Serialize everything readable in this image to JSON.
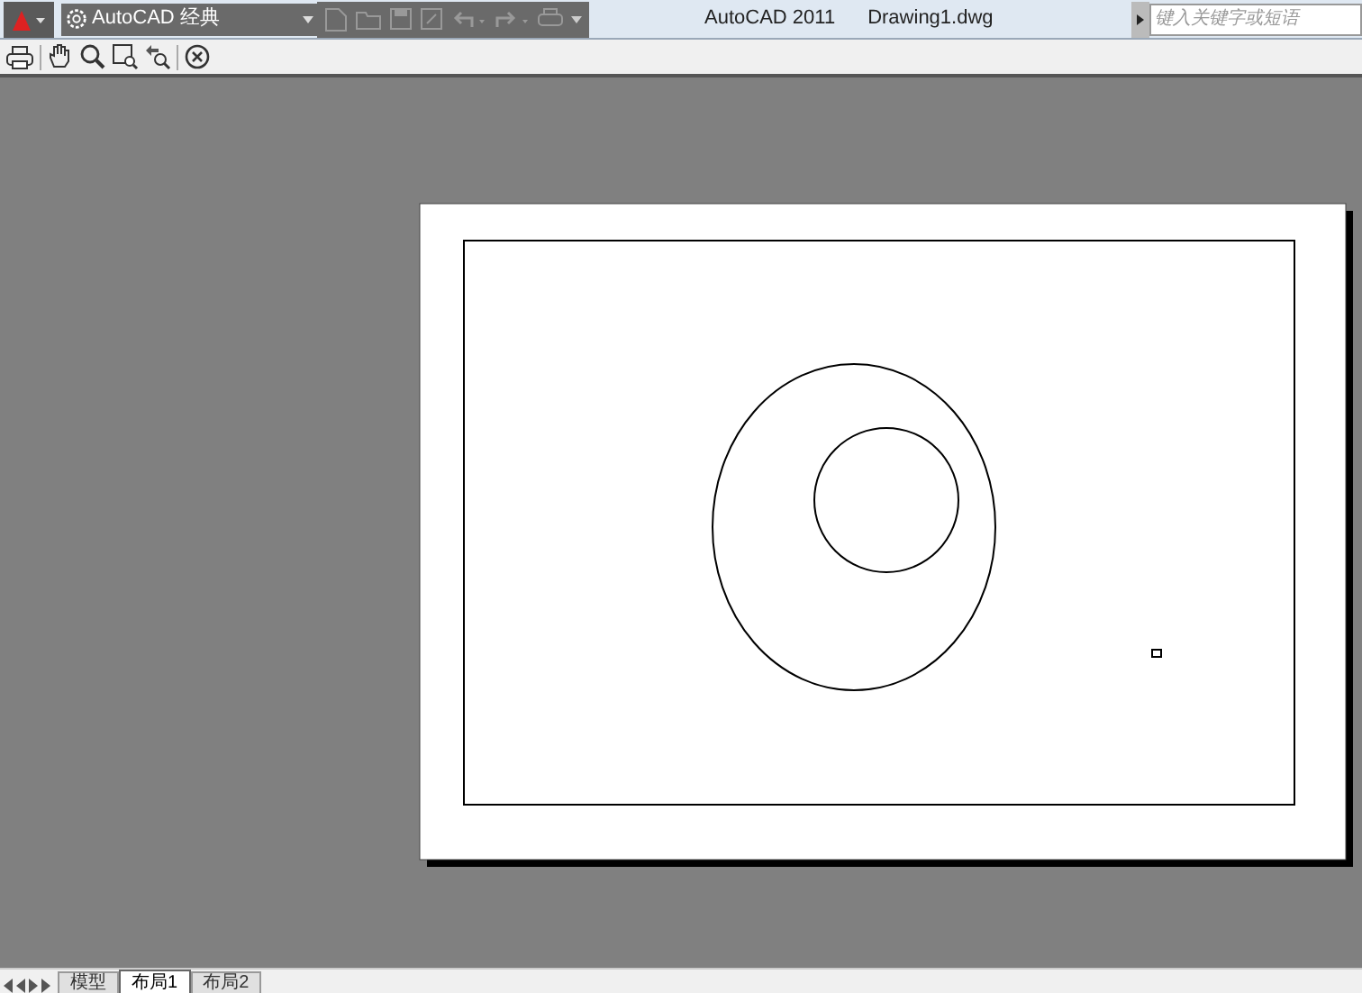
{
  "title_bar": {
    "workspace": "AutoCAD 经典",
    "app_title": "AutoCAD 2011",
    "document": "Drawing1.dwg",
    "search": {
      "placeholder": "键入关键字或短语"
    }
  },
  "layout_tabs": [
    {
      "label": "模型",
      "selected": false
    },
    {
      "label": "布局1",
      "selected": true
    },
    {
      "label": "布局2",
      "selected": false
    }
  ]
}
